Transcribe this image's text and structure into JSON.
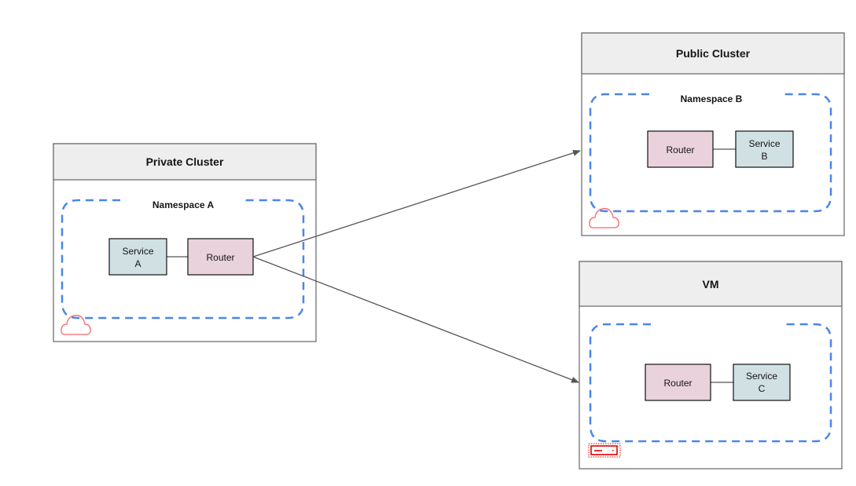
{
  "colors": {
    "namespace_border": "#4a86e8",
    "router_fill": "#e9d2dc",
    "service_fill": "#d0e0e3",
    "header_fill": "#eeeeee",
    "cloud_icon": "#f4676b",
    "server_icon": "#e00000",
    "connector": "#555555"
  },
  "private_cluster": {
    "title": "Private Cluster",
    "namespace": "Namespace A",
    "service": [
      "Service",
      "A"
    ],
    "router": "Router",
    "icon": "cloud-icon"
  },
  "public_cluster": {
    "title": "Public Cluster",
    "namespace": "Namespace B",
    "service": [
      "Service",
      "B"
    ],
    "router": "Router",
    "icon": "cloud-icon"
  },
  "vm": {
    "title": "VM",
    "namespace": "",
    "service": [
      "Service",
      "C"
    ],
    "router": "Router",
    "icon": "server-icon"
  }
}
